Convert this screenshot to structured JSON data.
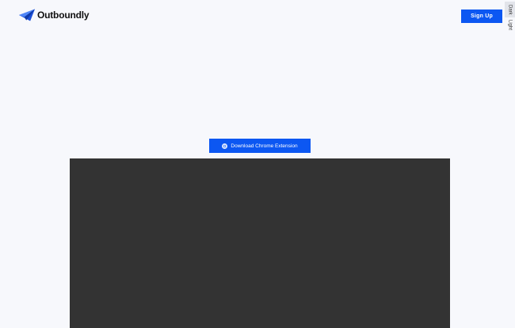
{
  "brand": {
    "name": "Outboundly",
    "accent_color": "#0c57f2",
    "logo_icon": "paper-plane-icon"
  },
  "header": {
    "signup_label": "Sign Up"
  },
  "theme_switch": {
    "options": [
      {
        "label": "Dark",
        "active": true
      },
      {
        "label": "Light",
        "active": false
      }
    ]
  },
  "hero": {
    "download_label": "Download Chrome Extension",
    "download_icon": "chrome-icon"
  },
  "video": {
    "background_color": "#333333"
  }
}
